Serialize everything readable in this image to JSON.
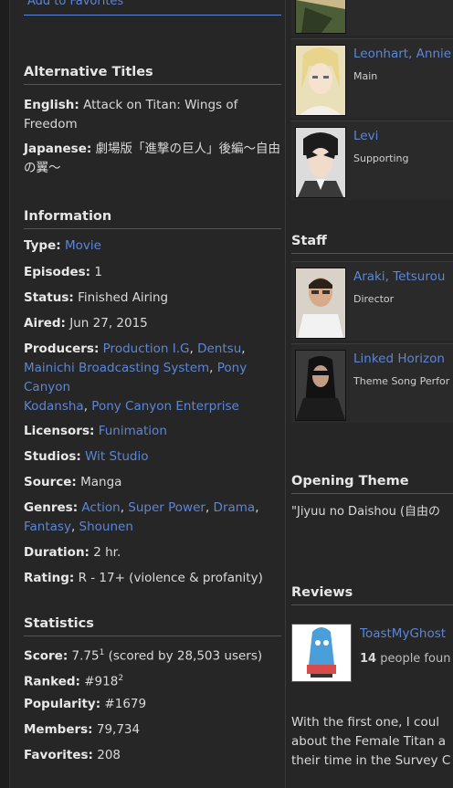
{
  "favorites": {
    "label": "Add to Favorites"
  },
  "alt_titles": {
    "heading": "Alternative Titles",
    "english_label": "English:",
    "english_value": "Attack on Titan: Wings of Freedom",
    "japanese_label": "Japanese:",
    "japanese_value": "劇場版「進撃の巨人」後編～自由の翼～"
  },
  "information": {
    "heading": "Information",
    "type_label": "Type:",
    "type_value": "Movie",
    "episodes_label": "Episodes:",
    "episodes_value": "1",
    "status_label": "Status:",
    "status_value": "Finished Airing",
    "aired_label": "Aired:",
    "aired_value": "Jun 27, 2015",
    "producers_label": "Producers:",
    "producers": [
      "Production I.G",
      "Dentsu",
      "Mainichi Broadcasting System",
      "Pony Canyon",
      "Kodansha",
      "Pony Canyon Enterprise"
    ],
    "licensors_label": "Licensors:",
    "licensors_value": "Funimation",
    "studios_label": "Studios:",
    "studios_value": "Wit Studio",
    "source_label": "Source:",
    "source_value": "Manga",
    "genres_label": "Genres:",
    "genres": [
      "Action",
      "Super Power",
      "Drama",
      "Fantasy",
      "Shounen"
    ],
    "duration_label": "Duration:",
    "duration_value": "2 hr.",
    "rating_label": "Rating:",
    "rating_value": "R - 17+ (violence & profanity)"
  },
  "statistics": {
    "heading": "Statistics",
    "score_label": "Score:",
    "score_value": "7.75",
    "score_sup": "1",
    "score_note": "(scored by 28,503 users)",
    "ranked_label": "Ranked:",
    "ranked_value": "#918",
    "ranked_sup": "2",
    "popularity_label": "Popularity:",
    "popularity_value": "#1679",
    "members_label": "Members:",
    "members_value": "79,734",
    "favorites_label": "Favorites:",
    "favorites_value": "208"
  },
  "characters": [
    {
      "name": "Leonhart, Annie",
      "role": "Main"
    },
    {
      "name": "Levi",
      "role": "Supporting"
    }
  ],
  "staff": {
    "heading": "Staff",
    "members": [
      {
        "name": "Araki, Tetsurou",
        "role": "Director"
      },
      {
        "name": "Linked Horizon",
        "role": "Theme Song Perfor"
      }
    ]
  },
  "opening_theme": {
    "heading": "Opening Theme",
    "text": "\"Jiyuu no Daishou (自由の"
  },
  "reviews": {
    "heading": "Reviews",
    "reviewer": "ToastMyGhost",
    "helpful_count": "14",
    "helpful_text": "people foun",
    "text_lines": [
      "With the first one, I coul",
      "about the Female Titan a",
      "their time in the Survey C"
    ]
  },
  "colors": {
    "link": "#5b86d6",
    "background": "#262626",
    "text": "#dadada"
  }
}
